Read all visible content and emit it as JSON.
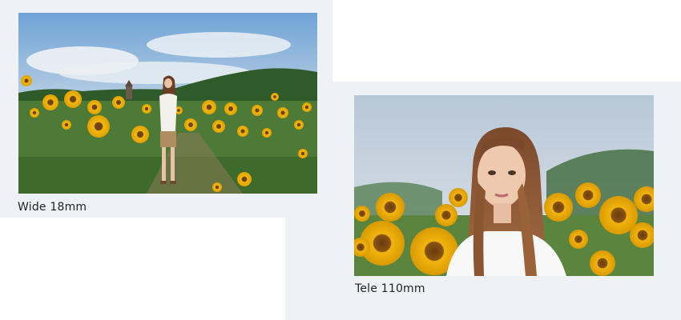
{
  "wide": {
    "caption": "Wide 18mm"
  },
  "tele": {
    "caption": "Tele 110mm"
  }
}
